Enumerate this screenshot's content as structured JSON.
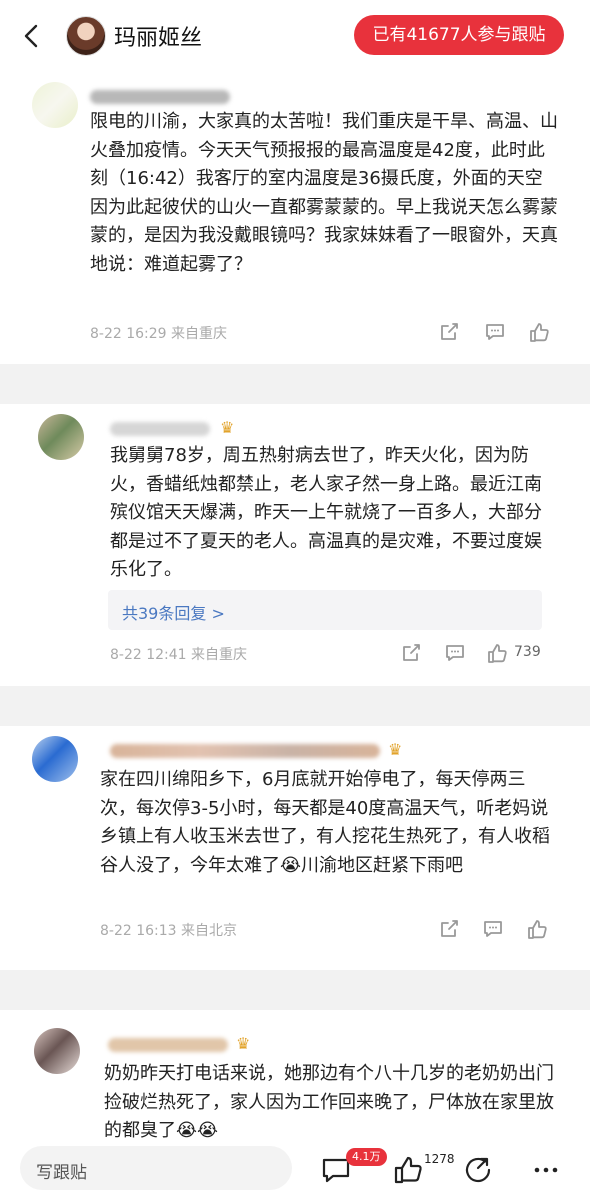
{
  "header": {
    "title": "玛丽姬丝",
    "badge": "已有41677人参与跟贴"
  },
  "posts": [
    {
      "text": "限电的川渝，大家真的太苦啦！我们重庆是干旱、高温、山火叠加疫情。今天天气预报报的最高温度是42度，此时此刻（16:42）我客厅的室内温度是36摄氏度，外面的天空因为此起彼伏的山火一直都雾蒙蒙的。早上我说天怎么雾蒙蒙的，是因为我没戴眼镜吗？我家妹妹看了一眼窗外，天真地说：难道起雾了？",
      "meta": "8-22 16:29 来自重庆",
      "like_count": ""
    },
    {
      "text": "我舅舅78岁，周五热射病去世了，昨天火化，因为防火，香蜡纸烛都禁止，老人家孑然一身上路。最近江南殡仪馆天天爆满，昨天一上午就烧了一百多人，大部分都是过不了夏天的老人。高温真的是灾难，不要过度娱乐化了。",
      "replies": "共39条回复 >",
      "meta": "8-22 12:41 来自重庆",
      "like_count": "739"
    },
    {
      "text": "家在四川绵阳乡下，6月底就开始停电了，每天停两三次，每次停3-5小时，每天都是40度高温天气，听老妈说乡镇上有人收玉米去世了，有人挖花生热死了，有人收稻谷人没了，今年太难了😭川渝地区赶紧下雨吧",
      "meta": "8-22 16:13 来自北京",
      "like_count": ""
    },
    {
      "text": "奶奶昨天打电话来说，她那边有个八十几岁的老奶奶出门捡破烂热死了，家人因为工作回来晚了，尸体放在家里放的都臭了😭😭",
      "meta": "",
      "like_count": ""
    }
  ],
  "bottom": {
    "compose_placeholder": "写跟贴",
    "comment_count": "4.1万",
    "like_count": "1278"
  }
}
